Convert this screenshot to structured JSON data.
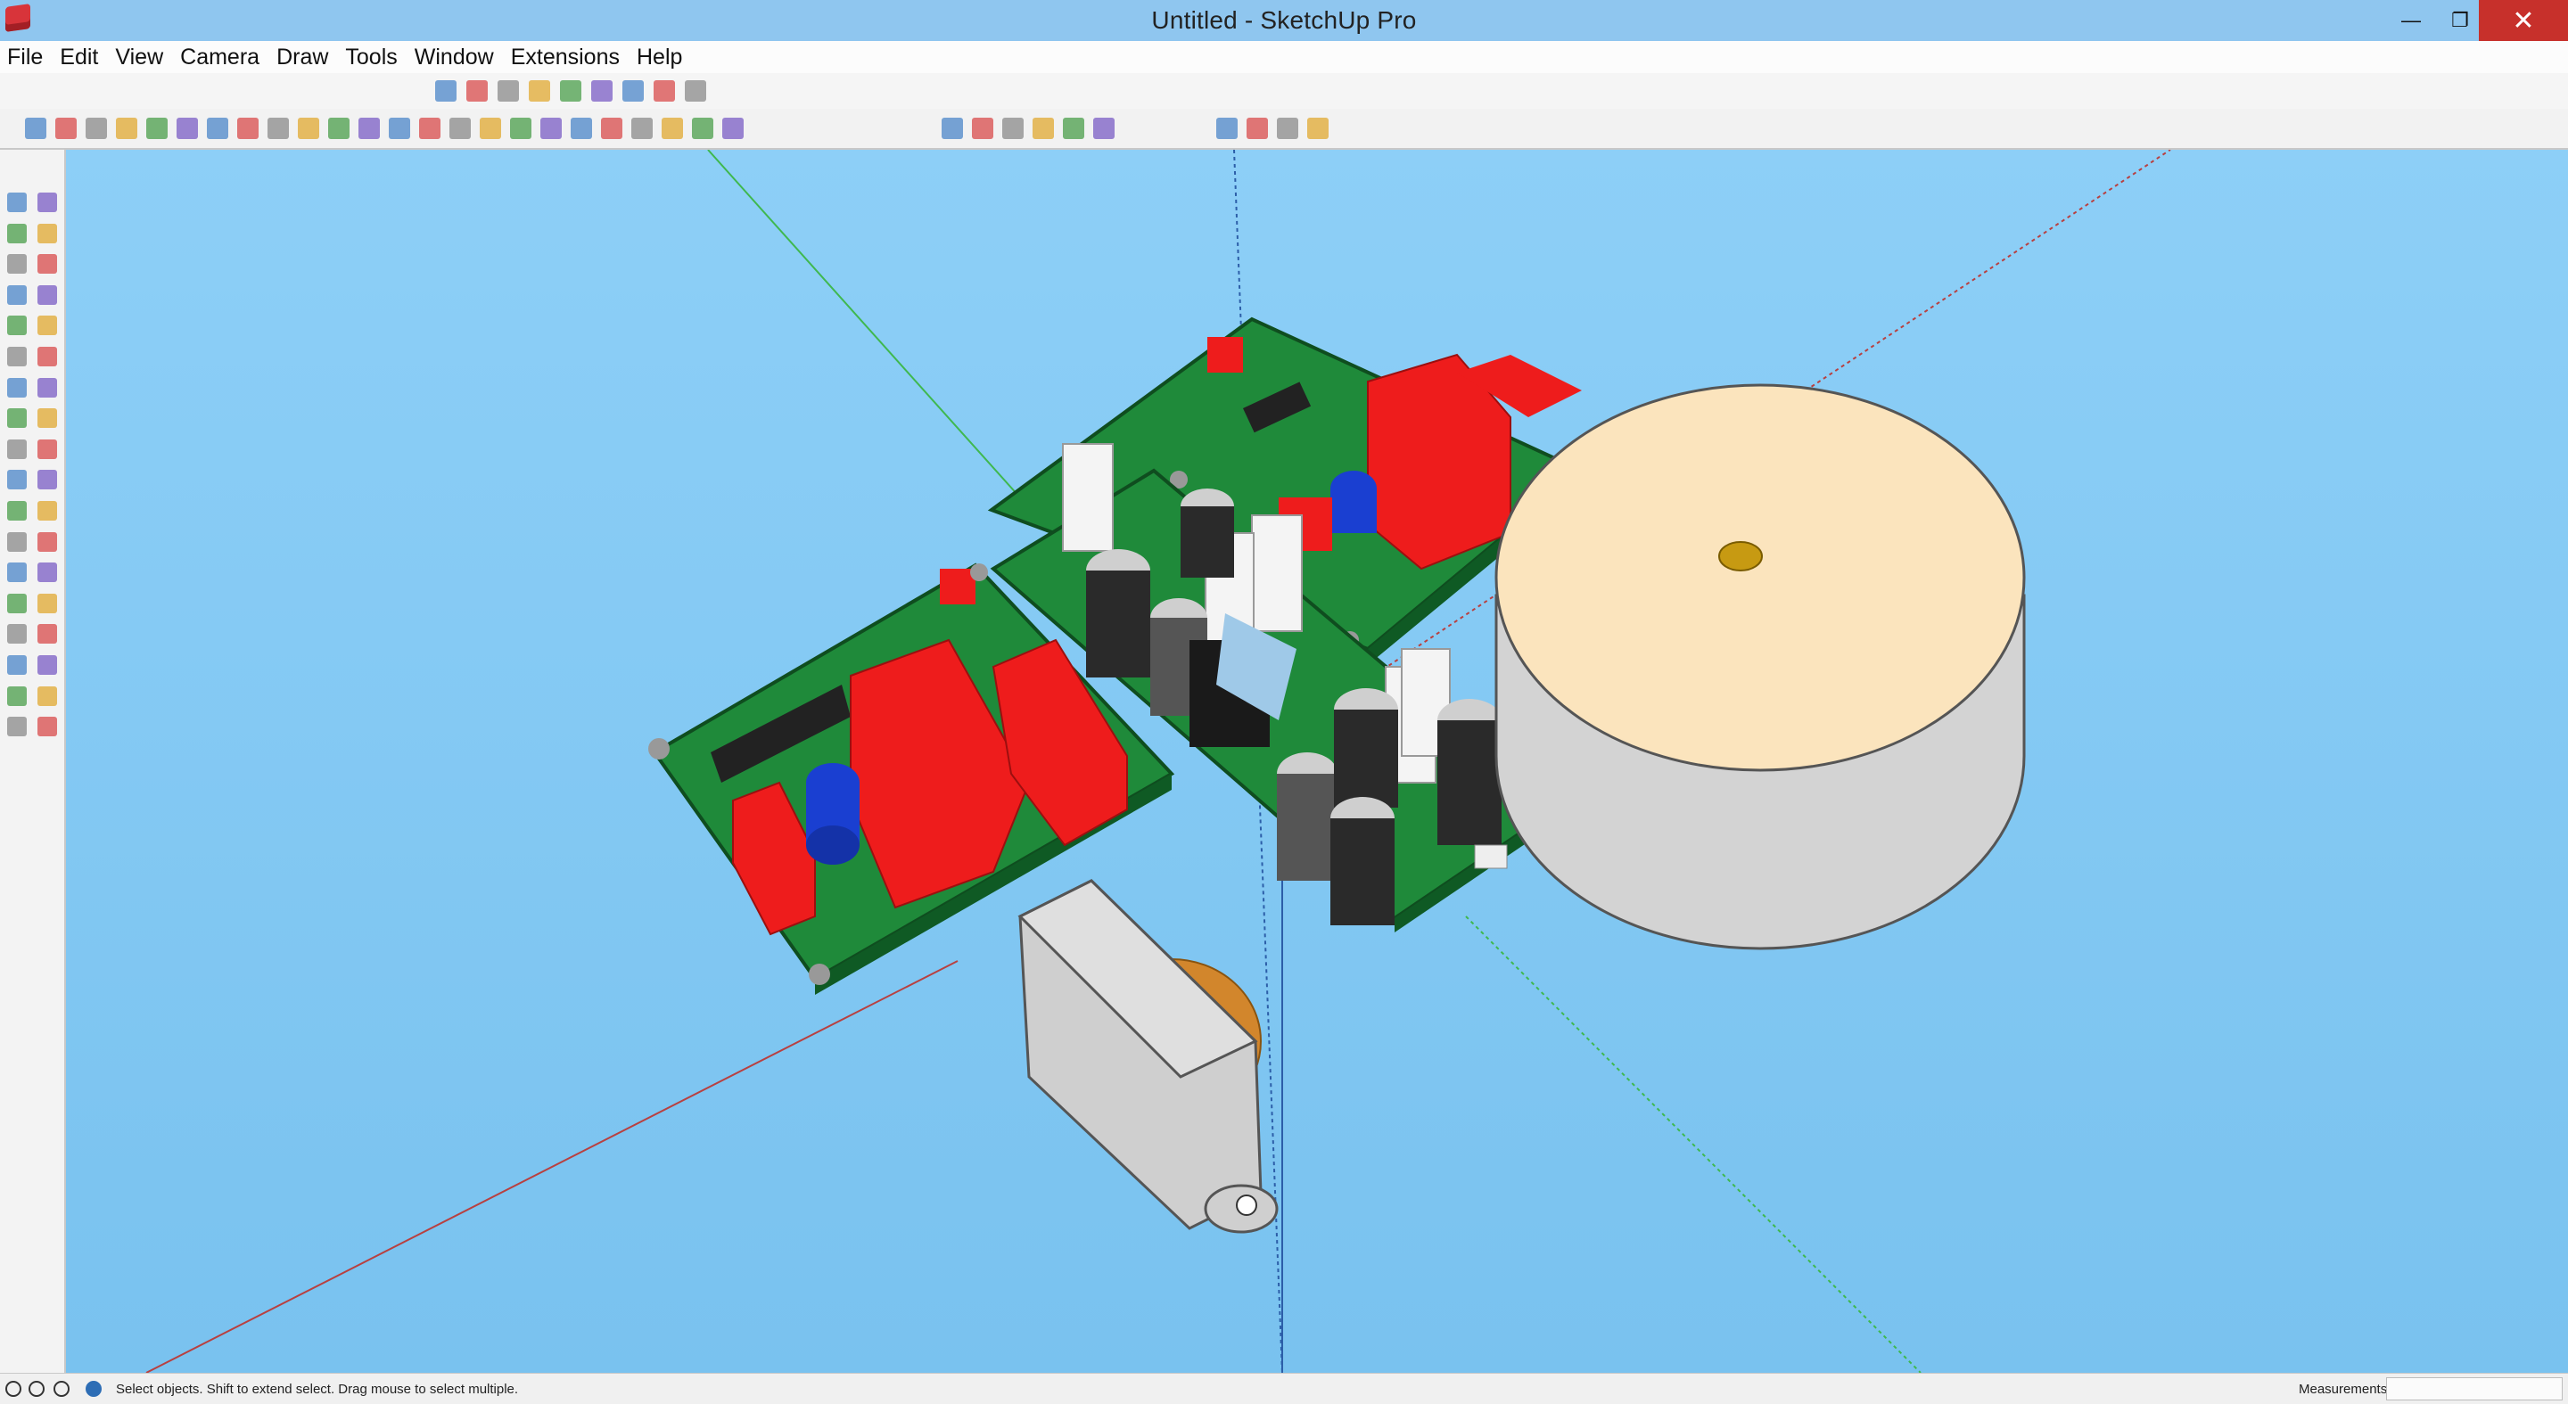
{
  "window": {
    "title": "Untitled - SketchUp Pro"
  },
  "window_controls": {
    "minimize": "—",
    "maximize": "❐",
    "close": "✕"
  },
  "menu": [
    "File",
    "Edit",
    "View",
    "Camera",
    "Draw",
    "Tools",
    "Window",
    "Extensions",
    "Help"
  ],
  "toolbar_views": [
    "iso-view-icon",
    "top-view-icon",
    "front-view-icon",
    "right-view-icon",
    "back-view-icon",
    "left-view-icon",
    "xray-style-icon",
    "wireframe-style-icon",
    "shaded-style-icon"
  ],
  "toolbar_main": [
    "select-icon",
    "eraser-icon",
    "pencil-icon",
    "line-dropdown-icon",
    "arc-icon",
    "arc-dropdown-icon",
    "circle-icon",
    "circle-dropdown-icon",
    "push-pull-icon",
    "follow-me-icon",
    "move-icon",
    "rotate-icon",
    "scale-icon",
    "tape-measure-icon",
    "text-icon",
    "paint-bucket-icon",
    "orbit-icon",
    "pan-icon",
    "zoom-icon",
    "zoom-extents-icon",
    "warehouse-icon",
    "extension-warehouse-icon",
    "share-model-icon",
    "layout-icon"
  ],
  "toolbar_camera": [
    "section-plane-icon",
    "standard-views-icon",
    "home-icon",
    "house-icon",
    "front-house-icon",
    "side-house-icon"
  ],
  "toolbar_extras": [
    "geo-location-icon",
    "shadows-icon",
    "fog-icon",
    "photo-icon"
  ],
  "sidebar_tools": [
    "select-icon",
    "make-component-icon",
    "paint-bucket-icon",
    "eraser-icon",
    "line-icon",
    "freehand-icon",
    "rectangle-icon",
    "rotated-rectangle-icon",
    "circle-icon",
    "polygon-icon",
    "arc-icon",
    "two-point-arc-icon",
    "three-point-arc-icon",
    "pie-icon",
    "move-icon",
    "push-pull-icon",
    "rotate-icon",
    "follow-me-icon",
    "scale-icon",
    "offset-icon",
    "tape-measure-icon",
    "dimension-icon",
    "protractor-icon",
    "text-icon",
    "axes-icon",
    "3d-text-icon",
    "orbit-icon",
    "pan-icon",
    "zoom-icon",
    "zoom-window-icon",
    "zoom-extents-icon",
    "previous-view-icon",
    "position-camera-icon",
    "look-around-icon",
    "walk-icon",
    "section-plane-icon"
  ],
  "status": {
    "hint": "Select objects. Shift to extend select. Drag mouse to select multiple.",
    "measurements_label": "Measurements",
    "measurements_value": ""
  },
  "colors": {
    "viewport_sky": "#8dcff7",
    "pcb_green": "#1f8a3a",
    "component_red": "#ee1c1c",
    "capacitor_blue": "#1a3fd1",
    "transformer_body": "#d6d6d6",
    "transformer_top": "#fbe4bd",
    "axis_red": "#b84040",
    "axis_green": "#3fb84f",
    "axis_blue": "#3c6fc2"
  }
}
